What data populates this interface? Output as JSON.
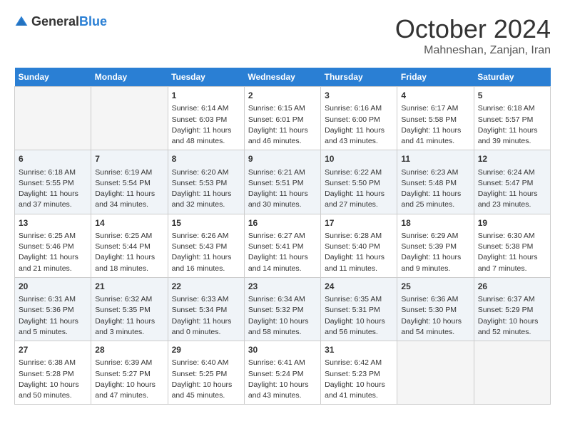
{
  "header": {
    "logo_general": "General",
    "logo_blue": "Blue",
    "month": "October 2024",
    "location": "Mahneshan, Zanjan, Iran"
  },
  "days_of_week": [
    "Sunday",
    "Monday",
    "Tuesday",
    "Wednesday",
    "Thursday",
    "Friday",
    "Saturday"
  ],
  "weeks": [
    [
      {
        "day": "",
        "sunrise": "",
        "sunset": "",
        "daylight": ""
      },
      {
        "day": "",
        "sunrise": "",
        "sunset": "",
        "daylight": ""
      },
      {
        "day": "1",
        "sunrise": "Sunrise: 6:14 AM",
        "sunset": "Sunset: 6:03 PM",
        "daylight": "Daylight: 11 hours and 48 minutes."
      },
      {
        "day": "2",
        "sunrise": "Sunrise: 6:15 AM",
        "sunset": "Sunset: 6:01 PM",
        "daylight": "Daylight: 11 hours and 46 minutes."
      },
      {
        "day": "3",
        "sunrise": "Sunrise: 6:16 AM",
        "sunset": "Sunset: 6:00 PM",
        "daylight": "Daylight: 11 hours and 43 minutes."
      },
      {
        "day": "4",
        "sunrise": "Sunrise: 6:17 AM",
        "sunset": "Sunset: 5:58 PM",
        "daylight": "Daylight: 11 hours and 41 minutes."
      },
      {
        "day": "5",
        "sunrise": "Sunrise: 6:18 AM",
        "sunset": "Sunset: 5:57 PM",
        "daylight": "Daylight: 11 hours and 39 minutes."
      }
    ],
    [
      {
        "day": "6",
        "sunrise": "Sunrise: 6:18 AM",
        "sunset": "Sunset: 5:55 PM",
        "daylight": "Daylight: 11 hours and 37 minutes."
      },
      {
        "day": "7",
        "sunrise": "Sunrise: 6:19 AM",
        "sunset": "Sunset: 5:54 PM",
        "daylight": "Daylight: 11 hours and 34 minutes."
      },
      {
        "day": "8",
        "sunrise": "Sunrise: 6:20 AM",
        "sunset": "Sunset: 5:53 PM",
        "daylight": "Daylight: 11 hours and 32 minutes."
      },
      {
        "day": "9",
        "sunrise": "Sunrise: 6:21 AM",
        "sunset": "Sunset: 5:51 PM",
        "daylight": "Daylight: 11 hours and 30 minutes."
      },
      {
        "day": "10",
        "sunrise": "Sunrise: 6:22 AM",
        "sunset": "Sunset: 5:50 PM",
        "daylight": "Daylight: 11 hours and 27 minutes."
      },
      {
        "day": "11",
        "sunrise": "Sunrise: 6:23 AM",
        "sunset": "Sunset: 5:48 PM",
        "daylight": "Daylight: 11 hours and 25 minutes."
      },
      {
        "day": "12",
        "sunrise": "Sunrise: 6:24 AM",
        "sunset": "Sunset: 5:47 PM",
        "daylight": "Daylight: 11 hours and 23 minutes."
      }
    ],
    [
      {
        "day": "13",
        "sunrise": "Sunrise: 6:25 AM",
        "sunset": "Sunset: 5:46 PM",
        "daylight": "Daylight: 11 hours and 21 minutes."
      },
      {
        "day": "14",
        "sunrise": "Sunrise: 6:25 AM",
        "sunset": "Sunset: 5:44 PM",
        "daylight": "Daylight: 11 hours and 18 minutes."
      },
      {
        "day": "15",
        "sunrise": "Sunrise: 6:26 AM",
        "sunset": "Sunset: 5:43 PM",
        "daylight": "Daylight: 11 hours and 16 minutes."
      },
      {
        "day": "16",
        "sunrise": "Sunrise: 6:27 AM",
        "sunset": "Sunset: 5:41 PM",
        "daylight": "Daylight: 11 hours and 14 minutes."
      },
      {
        "day": "17",
        "sunrise": "Sunrise: 6:28 AM",
        "sunset": "Sunset: 5:40 PM",
        "daylight": "Daylight: 11 hours and 11 minutes."
      },
      {
        "day": "18",
        "sunrise": "Sunrise: 6:29 AM",
        "sunset": "Sunset: 5:39 PM",
        "daylight": "Daylight: 11 hours and 9 minutes."
      },
      {
        "day": "19",
        "sunrise": "Sunrise: 6:30 AM",
        "sunset": "Sunset: 5:38 PM",
        "daylight": "Daylight: 11 hours and 7 minutes."
      }
    ],
    [
      {
        "day": "20",
        "sunrise": "Sunrise: 6:31 AM",
        "sunset": "Sunset: 5:36 PM",
        "daylight": "Daylight: 11 hours and 5 minutes."
      },
      {
        "day": "21",
        "sunrise": "Sunrise: 6:32 AM",
        "sunset": "Sunset: 5:35 PM",
        "daylight": "Daylight: 11 hours and 3 minutes."
      },
      {
        "day": "22",
        "sunrise": "Sunrise: 6:33 AM",
        "sunset": "Sunset: 5:34 PM",
        "daylight": "Daylight: 11 hours and 0 minutes."
      },
      {
        "day": "23",
        "sunrise": "Sunrise: 6:34 AM",
        "sunset": "Sunset: 5:32 PM",
        "daylight": "Daylight: 10 hours and 58 minutes."
      },
      {
        "day": "24",
        "sunrise": "Sunrise: 6:35 AM",
        "sunset": "Sunset: 5:31 PM",
        "daylight": "Daylight: 10 hours and 56 minutes."
      },
      {
        "day": "25",
        "sunrise": "Sunrise: 6:36 AM",
        "sunset": "Sunset: 5:30 PM",
        "daylight": "Daylight: 10 hours and 54 minutes."
      },
      {
        "day": "26",
        "sunrise": "Sunrise: 6:37 AM",
        "sunset": "Sunset: 5:29 PM",
        "daylight": "Daylight: 10 hours and 52 minutes."
      }
    ],
    [
      {
        "day": "27",
        "sunrise": "Sunrise: 6:38 AM",
        "sunset": "Sunset: 5:28 PM",
        "daylight": "Daylight: 10 hours and 50 minutes."
      },
      {
        "day": "28",
        "sunrise": "Sunrise: 6:39 AM",
        "sunset": "Sunset: 5:27 PM",
        "daylight": "Daylight: 10 hours and 47 minutes."
      },
      {
        "day": "29",
        "sunrise": "Sunrise: 6:40 AM",
        "sunset": "Sunset: 5:25 PM",
        "daylight": "Daylight: 10 hours and 45 minutes."
      },
      {
        "day": "30",
        "sunrise": "Sunrise: 6:41 AM",
        "sunset": "Sunset: 5:24 PM",
        "daylight": "Daylight: 10 hours and 43 minutes."
      },
      {
        "day": "31",
        "sunrise": "Sunrise: 6:42 AM",
        "sunset": "Sunset: 5:23 PM",
        "daylight": "Daylight: 10 hours and 41 minutes."
      },
      {
        "day": "",
        "sunrise": "",
        "sunset": "",
        "daylight": ""
      },
      {
        "day": "",
        "sunrise": "",
        "sunset": "",
        "daylight": ""
      }
    ]
  ]
}
